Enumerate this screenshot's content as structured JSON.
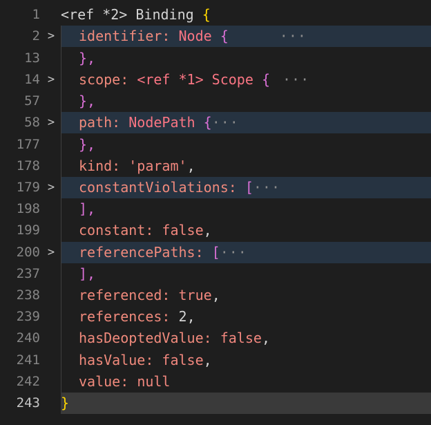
{
  "editor": {
    "lines": [
      {
        "num": "1",
        "fold": "",
        "text_a": "<ref *2> Binding ",
        "brace": "{",
        "text_b": "",
        "ellipsis": ""
      },
      {
        "num": "2",
        "fold": ">",
        "key": "identifier",
        "sep": ": ",
        "type": "Node ",
        "brace": "{",
        "ellipsis": "···"
      },
      {
        "num": "13",
        "close": "},"
      },
      {
        "num": "14",
        "fold": ">",
        "key": "scope",
        "sep": ": ",
        "type": "<ref *1> Scope ",
        "brace": "{",
        "ellipsis": "···"
      },
      {
        "num": "57",
        "close": "},"
      },
      {
        "num": "58",
        "fold": ">",
        "key": "path",
        "sep": ": ",
        "type": "NodePath ",
        "brace": "{",
        "ellipsis": "···"
      },
      {
        "num": "177",
        "close": "},"
      },
      {
        "num": "178",
        "key": "kind",
        "sep": ": ",
        "value": "'param'",
        "tail": ","
      },
      {
        "num": "179",
        "fold": ">",
        "key": "constantViolations",
        "sep": ": ",
        "brace": "[",
        "ellipsis": "···"
      },
      {
        "num": "198",
        "close": "],"
      },
      {
        "num": "199",
        "key": "constant",
        "sep": ": ",
        "value": "false",
        "tail": ","
      },
      {
        "num": "200",
        "fold": ">",
        "key": "referencePaths",
        "sep": ": ",
        "brace": "[",
        "ellipsis": "···"
      },
      {
        "num": "237",
        "close": "],"
      },
      {
        "num": "238",
        "key": "referenced",
        "sep": ": ",
        "value": "true",
        "tail": ","
      },
      {
        "num": "239",
        "key": "references",
        "sep": ": ",
        "value": "2",
        "tail": ","
      },
      {
        "num": "240",
        "key": "hasDeoptedValue",
        "sep": ": ",
        "value": "false",
        "tail": ","
      },
      {
        "num": "241",
        "key": "hasValue",
        "sep": ": ",
        "value": "false",
        "tail": ","
      },
      {
        "num": "242",
        "key": "value",
        "sep": ": ",
        "value": "null",
        "tail": ""
      },
      {
        "num": "243",
        "final": "}"
      }
    ],
    "header_ref": "<ref *2> Binding ",
    "header_brace": "{"
  },
  "colors": {
    "background": "#1e1e1e",
    "key": "#f08a7c",
    "brace_yellow": "#ffd700",
    "brace_magenta": "#da70d6",
    "folded_row": "#263341",
    "cursor_row": "#3a3a3a"
  }
}
